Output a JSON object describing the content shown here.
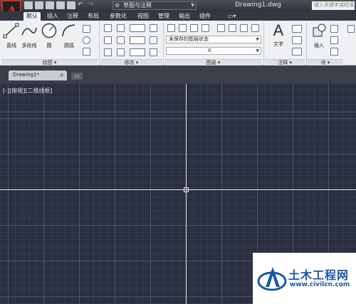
{
  "titlebar": {
    "app_letter": "A",
    "workspace": "草图与注释",
    "document_title": "Drawing1.dwg",
    "search_placeholder": "键入关键字或短语"
  },
  "tabs": [
    "默认",
    "插入",
    "注释",
    "布局",
    "参数化",
    "视图",
    "管理",
    "输出",
    "插件"
  ],
  "active_tab": "默认",
  "ribbon": {
    "draw": {
      "title": "绘图",
      "line": "直线",
      "polyline": "多段线",
      "circle": "圆",
      "arc": "圆弧"
    },
    "modify": {
      "title": "修改"
    },
    "layers": {
      "title": "图层",
      "layer_state": "未保存的图层状态",
      "current_layer": "0"
    },
    "annotation": {
      "title": "注释",
      "text": "文字"
    },
    "block": {
      "title": "块",
      "insert": "插入"
    }
  },
  "document_tab": {
    "label": "Drawing1*",
    "close": "×"
  },
  "viewport": {
    "label": "[-][俯视][二维线框]"
  },
  "watermark": {
    "title": "土木工程网",
    "url": "www.civilcn.com"
  },
  "colors": {
    "canvas": "#2b3040",
    "accent": "#d7261e",
    "watermark_blue": "#1b56a8"
  },
  "icons": [
    "new-icon",
    "open-icon",
    "save-icon",
    "save-as-icon",
    "print-icon",
    "undo-icon",
    "redo-icon",
    "gear-icon"
  ]
}
